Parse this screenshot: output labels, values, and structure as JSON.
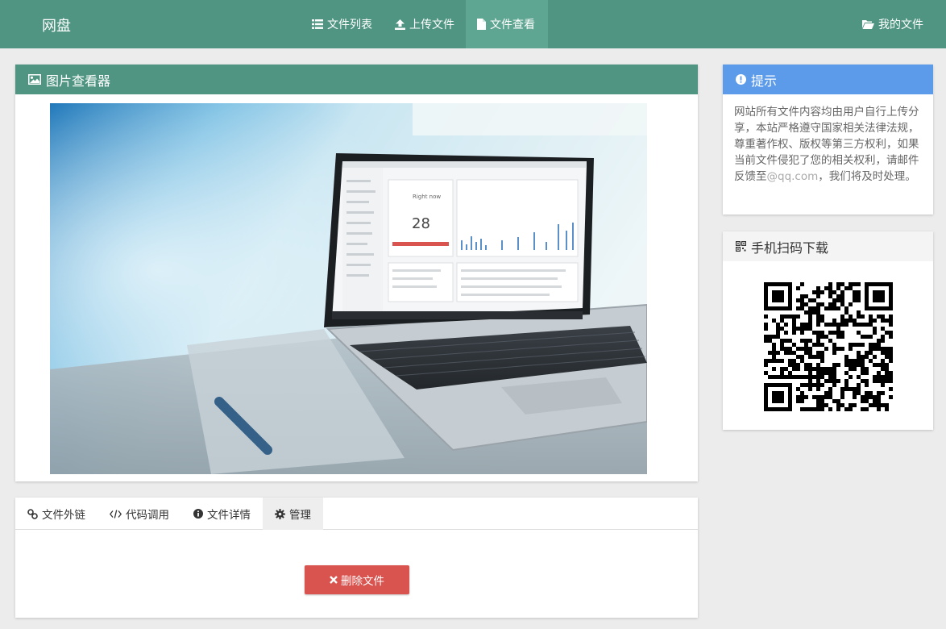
{
  "brand": "网盘",
  "nav": {
    "items": [
      {
        "label": "文件列表",
        "icon": "list-icon"
      },
      {
        "label": "上传文件",
        "icon": "upload-icon"
      },
      {
        "label": "文件查看",
        "icon": "file-icon",
        "active": true
      }
    ],
    "my_files": "我的文件"
  },
  "viewer": {
    "title": "图片查看器",
    "photo": {
      "description_icon": "laptop-photo",
      "screen_number": "28",
      "screen_caption": "Right now"
    }
  },
  "tabs": {
    "items": [
      {
        "label": "文件外链",
        "icon": "link-icon"
      },
      {
        "label": "代码调用",
        "icon": "code-icon"
      },
      {
        "label": "文件详情",
        "icon": "info-icon"
      },
      {
        "label": "管理",
        "icon": "gear-icon",
        "active": true
      }
    ],
    "delete_button": "删除文件"
  },
  "tip": {
    "title": "提示",
    "text_before": "网站所有文件内容均由用户自行上传分享，本站严格遵守国家相关法律法规，尊重著作权、版权等第三方权利，如果当前文件侵犯了您的相关权利，请邮件反馈至",
    "email": "@qq.com",
    "text_after": "，我们将及时处理。"
  },
  "qr": {
    "title": "手机扫码下载"
  },
  "colors": {
    "navbar": "#4f9582",
    "nav_active": "#5fa692",
    "tip_header": "#5b9bea",
    "delete_button": "#d9534f",
    "background": "#ececec"
  }
}
